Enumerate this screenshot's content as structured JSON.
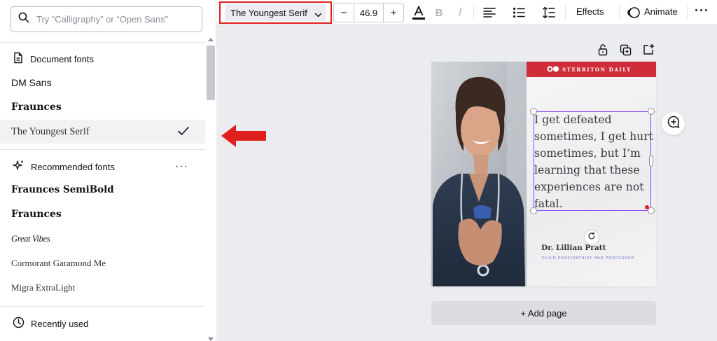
{
  "search": {
    "placeholder": "Try “Calligraphy” or “Open Sans”"
  },
  "document_fonts": {
    "heading": "Document fonts",
    "items": [
      {
        "label": "DM Sans",
        "selected": false
      },
      {
        "label": "Fraunces",
        "selected": false
      },
      {
        "label": "The Youngest Serif",
        "selected": true
      }
    ]
  },
  "recommended_fonts": {
    "heading": "Recommended fonts",
    "more": "···",
    "items": [
      {
        "label": "Fraunces SemiBold"
      },
      {
        "label": "Fraunces"
      },
      {
        "label": "Great Vibes"
      },
      {
        "label": "Cormorant Garamond Me"
      },
      {
        "label": "Migra ExtraLight"
      }
    ]
  },
  "recently_used": {
    "heading": "Recently used"
  },
  "toolbar": {
    "font_name": "The Youngest Serif",
    "font_size": "46.9",
    "decrease": "−",
    "increase": "+",
    "bold": "B",
    "italic": "I",
    "effects": "Effects",
    "animate": "Animate",
    "more": "···"
  },
  "design": {
    "brand": "STERRITON DAILY",
    "quote": "I get defeated sometimes, I get hurt sometimes, but I’m learning that these experiences are not fatal.",
    "author": "Dr. Lillian Pratt",
    "author_title": "CHILD PSYCHIATRIST AND PROFESSOR"
  },
  "add_page": "+ Add page",
  "colors": {
    "accent_red": "#e0201f",
    "selection_purple": "#8b3dff",
    "brand_red": "#cf2d3a"
  }
}
